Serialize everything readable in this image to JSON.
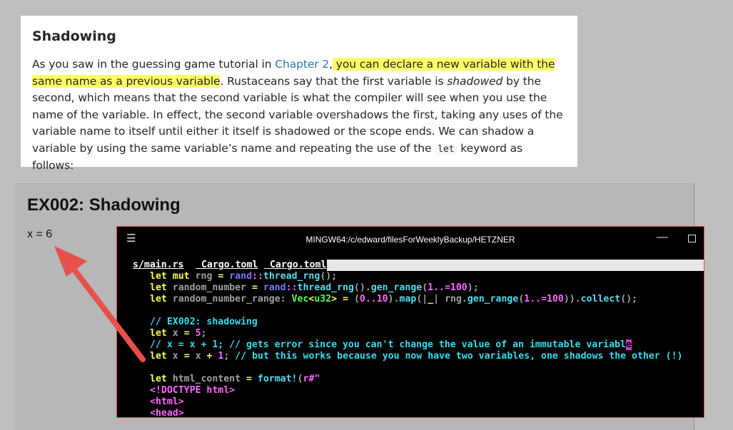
{
  "doc": {
    "heading": "Shadowing",
    "para": {
      "s1": "As you saw in the guessing game tutorial in ",
      "link": "Chapter 2",
      "s2": ",",
      "highlight": " you can declare a new variable with the same name as a previous variable",
      "s3": ". Rustaceans say that the first variable is ",
      "em": "shadowed",
      "s4": " by the second, which means that the second variable is what the compiler will see when you use the name of the variable. In effect, the second variable overshadows the first, taking any uses of the variable name to itself until either it itself is shadowed or the scope ends. We can shadow a variable by using the same variable’s name and repeating the use of the ",
      "code": "let",
      "s5": " keyword as follows:"
    }
  },
  "output": {
    "title": "EX002: Shadowing",
    "value": "x = 6"
  },
  "terminal": {
    "title": "MINGW64:/c/edward/filesForWeeklyBackup/HETZNER",
    "tabs": [
      "s/main.rs",
      " Cargo.toml",
      " Cargo.toml"
    ],
    "code": {
      "l1": [
        "let",
        "mut",
        "rng",
        "=",
        "rand",
        "::",
        "thread_rng",
        "();"
      ],
      "l2": [
        "let",
        "random_number",
        "=",
        "rand",
        "::",
        "thread_rng",
        "().",
        "gen_range",
        "(",
        "1..=100",
        ");"
      ],
      "l3": [
        "let",
        "random_number_range:",
        "Vec",
        "<",
        "u32",
        ">",
        "=",
        "(",
        "0..10",
        ").",
        "map",
        "(|",
        "_",
        "|",
        "rng.",
        "gen_range",
        "(",
        "1..=100",
        ")).",
        "collect",
        "();"
      ],
      "c1": "// EX002: shadowing",
      "l5": [
        "let",
        "x",
        "=",
        "5",
        ";"
      ],
      "c2": "// x = x + 1; // gets error since you can't change the value of an immutable variabl",
      "cursor": "e",
      "l7": [
        "let",
        "x",
        "=",
        "x",
        "+",
        "1",
        ";",
        "// but this works because you now have two variables, one shadows the other (!)"
      ],
      "l9": [
        "let",
        "html_content",
        "=",
        "format!",
        "(",
        "r#\""
      ],
      "h1": "<!DOCTYPE html>",
      "h2": "<html>",
      "h3": "<head>"
    }
  },
  "colors": {
    "highlight": "#ffff66",
    "link": "#2b79a2",
    "arrow": "#e8504b",
    "terminal_border": "#e14848"
  },
  "icons": {
    "menu": "hamburger-menu-icon",
    "minimize": "minimize-icon",
    "maximize": "maximize-icon",
    "arrow": "red-arrow-annotation"
  }
}
